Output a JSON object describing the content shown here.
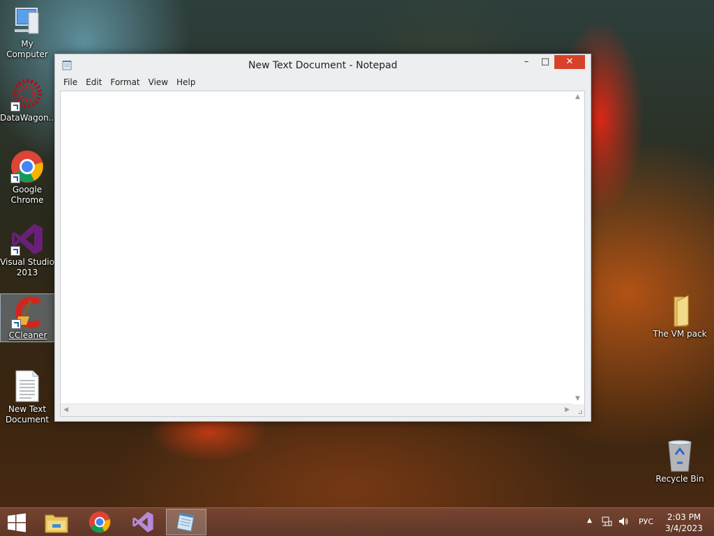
{
  "desktop": {
    "icons": [
      {
        "label": "My Computer"
      },
      {
        "label": "DataWagon..."
      },
      {
        "label": "Google Chrome"
      },
      {
        "label": "Visual Studio 2013"
      },
      {
        "label": "CCleaner"
      },
      {
        "label": "New Text Document"
      },
      {
        "label": "The VM pack"
      },
      {
        "label": "Recycle Bin"
      }
    ]
  },
  "window": {
    "title": "New Text Document - Notepad",
    "menu": [
      "File",
      "Edit",
      "Format",
      "View",
      "Help"
    ],
    "editor_text": "",
    "controls": {
      "minimize": "–",
      "maximize": "□",
      "close": "✕"
    }
  },
  "taskbar": {
    "buttons": [
      "start-icon",
      "file-explorer-icon",
      "chrome-icon",
      "visual-studio-icon",
      "notepad-icon"
    ],
    "language": "РУС",
    "time": "2:03 PM",
    "date": "3/4/2023"
  },
  "colors": {
    "close_button": "#d7412a",
    "taskbar": "#6e4030",
    "selection": "#aac8e6"
  }
}
